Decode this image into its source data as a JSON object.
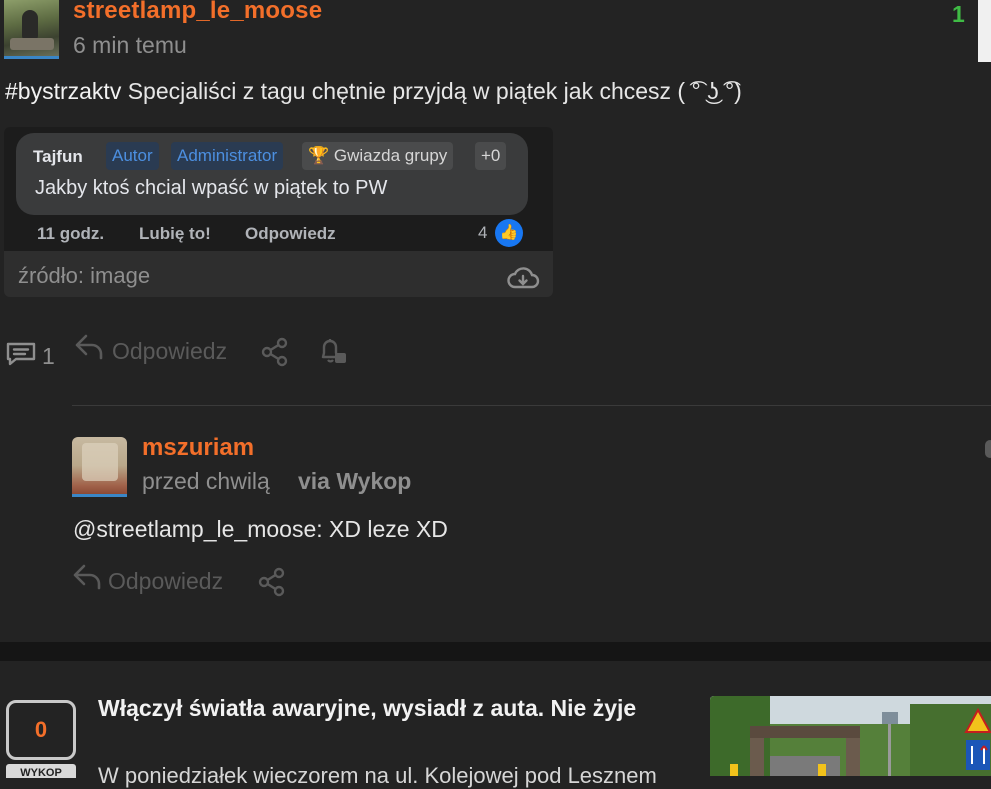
{
  "post": {
    "author": "streetlamp_le_moose",
    "time": "6 min temu",
    "votes": "1",
    "hashtag": "#bystrzaktv",
    "text": " Specjaliści z tagu chętnie przyjdą w piątek jak chcesz ( ͡° ͜ʖ ͡°)",
    "comments_count": "1",
    "reply_label": "Odpowiedz"
  },
  "embed": {
    "source_label": "źródło: image",
    "fb": {
      "author": "Tajfun",
      "badges": [
        "Autor",
        "Administrator",
        "🏆 Gwiazda grupy",
        "+0"
      ],
      "text": "Jakby ktoś chcial wpaść w piątek to PW",
      "time": "11 godz.",
      "like": "Lubię to!",
      "reply": "Odpowiedz",
      "like_count": "4"
    }
  },
  "reply_comment": {
    "author": "mszuriam",
    "time": "przed chwilą",
    "via": "via Wykop",
    "text": "@streetlamp_le_moose: XD leze XD",
    "reply_label": "Odpowiedz"
  },
  "next_item": {
    "digg_count": "0",
    "digg_tab": "WYKOP",
    "title": "Włączył światła awaryjne, wysiadł z auta. Nie żyje",
    "snippet": "W poniedziałek wieczorem na ul. Kolejowej pod Lesznem"
  },
  "colors": {
    "accent": "#f36f2a",
    "vote_positive": "#3fbb45",
    "background": "#232323",
    "muted": "#8f8f8f"
  }
}
